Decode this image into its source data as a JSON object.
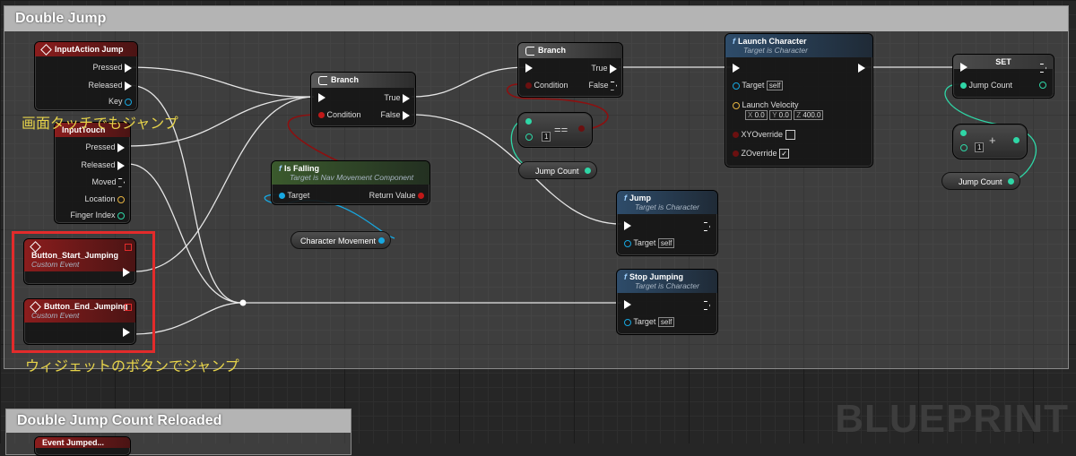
{
  "comments": {
    "main_title": "Double Jump",
    "second_title": "Double Jump Count Reloaded"
  },
  "annotations": {
    "touch_note": "画面タッチでもジャンプ",
    "widget_note": "ウィジェットのボタンでジャンプ"
  },
  "watermark": "BLUEPRINT",
  "nodes": {
    "input_action": {
      "title": "InputAction Jump",
      "pins": [
        "Pressed",
        "Released",
        "Key"
      ]
    },
    "input_touch": {
      "title": "InputTouch",
      "pins": [
        "Pressed",
        "Released",
        "Moved",
        "Location",
        "Finger Index"
      ]
    },
    "start_jumping": {
      "title": "Button_Start_Jumping",
      "subtitle": "Custom Event"
    },
    "end_jumping": {
      "title": "Button_End_Jumping",
      "subtitle": "Custom Event"
    },
    "branch1": {
      "title": "Branch",
      "condition": "Condition",
      "true_label": "True",
      "false_label": "False"
    },
    "branch2": {
      "title": "Branch",
      "condition": "Condition",
      "true_label": "True",
      "false_label": "False"
    },
    "is_falling": {
      "title": "Is Falling",
      "subtitle": "Target is Nav Movement Component",
      "target": "Target",
      "return": "Return Value"
    },
    "character_movement": {
      "label": "Character Movement"
    },
    "equal": {
      "symbol": "==",
      "value": "1"
    },
    "jump_count_get1": {
      "label": "Jump Count"
    },
    "launch": {
      "title": "Launch Character",
      "subtitle": "Target is Character",
      "target": "Target",
      "target_val": "self",
      "velocity": "Launch Velocity",
      "x_label": "X",
      "x": "0.0",
      "y_label": "Y",
      "y": "0.0",
      "z_label": "Z",
      "z": "400.0",
      "xy_override": "XYOverride",
      "z_override": "ZOverride"
    },
    "jump": {
      "title": "Jump",
      "subtitle": "Target is Character",
      "target": "Target",
      "target_val": "self"
    },
    "stop_jumping": {
      "title": "Stop Jumping",
      "subtitle": "Target is Character",
      "target": "Target",
      "target_val": "self"
    },
    "set": {
      "title": "SET",
      "pin": "Jump Count"
    },
    "add": {
      "symbol": "+",
      "value": "1"
    },
    "jump_count_get2": {
      "label": "Jump Count"
    },
    "event_partial": {
      "title": "Event Jumped..."
    }
  },
  "colors": {
    "exec_wire": "#e6e6e6",
    "bool_wire": "#8b1010",
    "object_wire": "#17a7e0",
    "int_wire": "#2fd6a6",
    "highlight": "#e32b2b",
    "note_text": "#e6d34a"
  }
}
